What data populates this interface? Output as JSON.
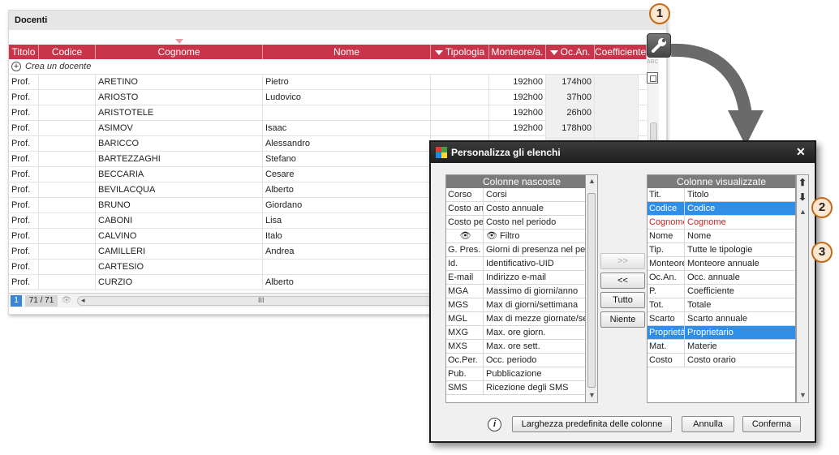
{
  "list_window": {
    "title": "Docenti",
    "columns": [
      {
        "label": "Titolo",
        "sort": false
      },
      {
        "label": "Codice",
        "sort": false
      },
      {
        "label": "Cognome",
        "sort": false
      },
      {
        "label": "Nome",
        "sort": false
      },
      {
        "label": "Tipologia",
        "sort": true
      },
      {
        "label": "Monteore/a.",
        "sort": false
      },
      {
        "label": "Oc.An.",
        "sort": true
      },
      {
        "label": "Coefficiente",
        "sort": false
      }
    ],
    "create_label": "Crea un docente",
    "rows": [
      {
        "titolo": "Prof.",
        "codice": "",
        "cognome": "ARETINO",
        "nome": "Pietro",
        "tipologia": "",
        "monteore": "192h00",
        "ocan": "174h00"
      },
      {
        "titolo": "Prof.",
        "codice": "",
        "cognome": "ARIOSTO",
        "nome": "Ludovico",
        "tipologia": "",
        "monteore": "192h00",
        "ocan": "37h00"
      },
      {
        "titolo": "Prof.",
        "codice": "",
        "cognome": "ARISTOTELE",
        "nome": "",
        "tipologia": "",
        "monteore": "192h00",
        "ocan": "26h00"
      },
      {
        "titolo": "Prof.",
        "codice": "",
        "cognome": "ASIMOV",
        "nome": "Isaac",
        "tipologia": "",
        "monteore": "192h00",
        "ocan": "178h00"
      },
      {
        "titolo": "Prof.",
        "codice": "",
        "cognome": "BARICCO",
        "nome": "Alessandro",
        "tipologia": "",
        "monteore": "",
        "ocan": ""
      },
      {
        "titolo": "Prof.",
        "codice": "",
        "cognome": "BARTEZZAGHI",
        "nome": "Stefano",
        "tipologia": "",
        "monteore": "",
        "ocan": ""
      },
      {
        "titolo": "Prof.",
        "codice": "",
        "cognome": "BECCARIA",
        "nome": "Cesare",
        "tipologia": "",
        "monteore": "",
        "ocan": ""
      },
      {
        "titolo": "Prof.",
        "codice": "",
        "cognome": "BEVILACQUA",
        "nome": "Alberto",
        "tipologia": "",
        "monteore": "",
        "ocan": ""
      },
      {
        "titolo": "Prof.",
        "codice": "",
        "cognome": "BRUNO",
        "nome": "Giordano",
        "tipologia": "",
        "monteore": "",
        "ocan": ""
      },
      {
        "titolo": "Prof.",
        "codice": "",
        "cognome": "CABONI",
        "nome": "Lisa",
        "tipologia": "",
        "monteore": "",
        "ocan": ""
      },
      {
        "titolo": "Prof.",
        "codice": "",
        "cognome": "CALVINO",
        "nome": "Italo",
        "tipologia": "",
        "monteore": "",
        "ocan": ""
      },
      {
        "titolo": "Prof.",
        "codice": "",
        "cognome": "CAMILLERI",
        "nome": "Andrea",
        "tipologia": "",
        "monteore": "",
        "ocan": ""
      },
      {
        "titolo": "Prof.",
        "codice": "",
        "cognome": "CARTESIO",
        "nome": "",
        "tipologia": "",
        "monteore": "",
        "ocan": ""
      },
      {
        "titolo": "Prof.",
        "codice": "",
        "cognome": "CURZIO",
        "nome": "Alberto",
        "tipologia": "",
        "monteore": "",
        "ocan": ""
      }
    ],
    "footer": {
      "page": "1",
      "count": "71 / 71",
      "scroll_grip": "III"
    },
    "toolbar": {
      "abc": "ABC"
    }
  },
  "callouts": [
    "1",
    "2",
    "3"
  ],
  "dialog": {
    "title": "Personalizza gli elenchi",
    "close": "✕",
    "hidden_header": "Colonne nascoste",
    "hidden_rows": [
      {
        "code": "Corso",
        "name": "Corsi"
      },
      {
        "code": "Costo an",
        "name": "Costo annuale"
      },
      {
        "code": "Costo pe",
        "name": "Costo nel periodo"
      },
      {
        "code": "👁",
        "name": "👁 Filtro"
      },
      {
        "code": "G. Pres.",
        "name": "Giorni di presenza nel pe"
      },
      {
        "code": "Id.",
        "name": "Identificativo-UID"
      },
      {
        "code": "E-mail",
        "name": "Indirizzo e-mail"
      },
      {
        "code": "MGA",
        "name": "Massimo di giorni/anno"
      },
      {
        "code": "MGS",
        "name": "Max di giorni/settimana"
      },
      {
        "code": "MGL",
        "name": "Max di mezze giornate/se"
      },
      {
        "code": "MXG",
        "name": "Max. ore giorn."
      },
      {
        "code": "MXS",
        "name": "Max. ore sett."
      },
      {
        "code": "Oc.Per.",
        "name": "Occ. periodo"
      },
      {
        "code": "Pub.",
        "name": "Pubblicazione"
      },
      {
        "code": "SMS",
        "name": "Ricezione degli SMS"
      }
    ],
    "visible_header": "Colonne visualizzate",
    "visible_rows": [
      {
        "code": "Tit.",
        "name": "Titolo",
        "state": ""
      },
      {
        "code": "Codice",
        "name": "Codice",
        "state": "sel"
      },
      {
        "code": "Cognome",
        "name": "Cognome",
        "state": "red"
      },
      {
        "code": "Nome",
        "name": "Nome",
        "state": ""
      },
      {
        "code": "Tip.",
        "name": "Tutte le tipologie",
        "state": ""
      },
      {
        "code": "Monteore",
        "name": "Monteore annuale",
        "state": ""
      },
      {
        "code": "Oc.An.",
        "name": "Occ. annuale",
        "state": ""
      },
      {
        "code": "P.",
        "name": "Coefficiente",
        "state": ""
      },
      {
        "code": "Tot.",
        "name": "Totale",
        "state": ""
      },
      {
        "code": "Scarto",
        "name": "Scarto annuale",
        "state": ""
      },
      {
        "code": "Proprietà",
        "name": "Proprietario",
        "state": "sel"
      },
      {
        "code": "Mat.",
        "name": "Materie",
        "state": ""
      },
      {
        "code": "Costo",
        "name": "Costo orario",
        "state": ""
      }
    ],
    "buttons": {
      "add": ">>",
      "remove": "<<",
      "all": "Tutto",
      "none": "Niente",
      "default_width": "Larghezza predefinita delle colonne",
      "cancel": "Annulla",
      "confirm": "Conferma"
    },
    "info": "i"
  },
  "colors": {
    "header_red": "#c8354a",
    "selection_blue": "#2f8fe6",
    "callout_border": "#c26a1a",
    "arrow_gray": "#6a6a6a"
  }
}
